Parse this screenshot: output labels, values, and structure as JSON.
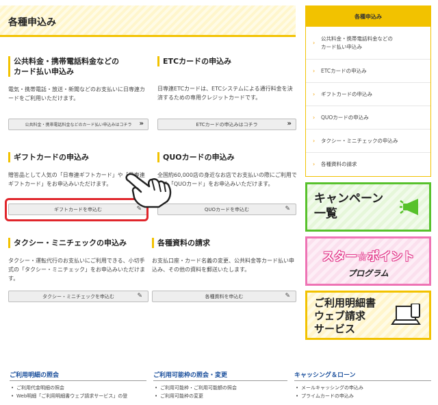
{
  "header": {
    "title": "各種申込み"
  },
  "sections": {
    "public": {
      "title_line1": "公共料金・携帯電話料金などの",
      "title_line2": "カード払い申込み",
      "desc": "電気・携帯電話・放送・新聞などのお支払いに日専連カードをご利用いただけます。",
      "button": "公共料金・携帯電話料金などのカード払い申込みはコチラ"
    },
    "etc": {
      "title": "ETCカードの申込み",
      "desc": "日専連ETCカードは、ETCシステムによる通行料金を決済するための専用クレジットカードです。",
      "button": "ETCカードの申込みはコチラ"
    },
    "gift": {
      "title": "ギフトカードの申込み",
      "desc": "贈答品として人気の「日専連ギフトカード」や「日専連ギフトカード」をお申込みいただけます。",
      "button": "ギフトカードを申込む"
    },
    "quo": {
      "title": "QUOカードの申込み",
      "desc": "全国約60,000店の身近なお店でお支払いの際にご利用できる「QUOカード」をお申込みいただけます。",
      "button": "QUOカードを申込む"
    },
    "taxi": {
      "title": "タクシー・ミニチェックの申込み",
      "desc": "タクシー・運転代行のお支払いにご利用できる、小切手式の「タクシー・ミニチェック」をお申込みいただけます。",
      "button": "タクシー・ミニチェックを申込む"
    },
    "docs": {
      "title": "各種資料の請求",
      "desc": "お支払口座・カード名義の変更、公共料金等カード払い申込み、その他の資料を郵送いたします。",
      "button": "各種資料を申込む"
    }
  },
  "sidebar": {
    "title": "各種申込み",
    "items": [
      {
        "line1": "公共料金・携帯電話料金などの",
        "line2": "カード払い申込み"
      },
      {
        "line1": "ETCカードの申込み",
        "line2": ""
      },
      {
        "line1": "ギフトカードの申込み",
        "line2": ""
      },
      {
        "line1": "QUOカードの申込み",
        "line2": ""
      },
      {
        "line1": "タクシー・ミニチェックの申込み",
        "line2": ""
      },
      {
        "line1": "各種資料の請求",
        "line2": ""
      }
    ]
  },
  "banners": {
    "campaign": {
      "line1": "キャンペーン",
      "line2": "一覧"
    },
    "star": {
      "line1": "スター☆ポイント",
      "line2": "プログラム"
    },
    "statement": {
      "line1": "ご利用明細書",
      "line2": "ウェブ請求",
      "line3": "サービス"
    }
  },
  "footer": {
    "col1": {
      "title": "ご利用明細の照会",
      "items": [
        "ご利用代金明細の照会",
        "Web明細「ご利用明細書ウェブ請求サービス」の登"
      ]
    },
    "col2": {
      "title": "ご利用可能枠の照会・変更",
      "items": [
        "ご利用可能枠・ご利用可能額の照会",
        "ご利用可能枠の変更"
      ]
    },
    "col3": {
      "title": "キャッシング＆ローン",
      "items": [
        "メールキャッシングの申込み",
        "プライムカードの申込み"
      ]
    }
  },
  "colors": {
    "accent": "#f2c200",
    "highlight": "#e0252b",
    "green": "#57c12b",
    "pink": "#ee73b4",
    "link": "#1a4f9c"
  }
}
